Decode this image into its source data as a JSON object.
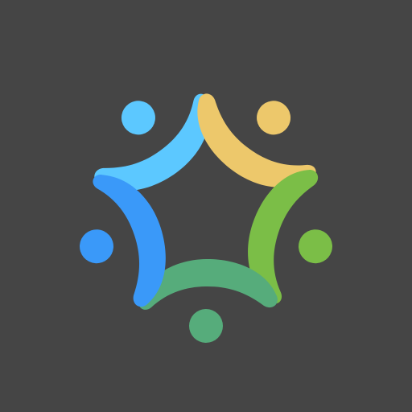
{
  "background": "#454545",
  "logo": {
    "icon": "community-people-circle-icon",
    "figures": [
      {
        "name": "figure-light-blue",
        "color": "#5CC8FF"
      },
      {
        "name": "figure-yellow",
        "color": "#EDC86B"
      },
      {
        "name": "figure-green",
        "color": "#7BBE47"
      },
      {
        "name": "figure-teal",
        "color": "#56AC7B"
      },
      {
        "name": "figure-blue",
        "color": "#3A99F9"
      }
    ]
  }
}
